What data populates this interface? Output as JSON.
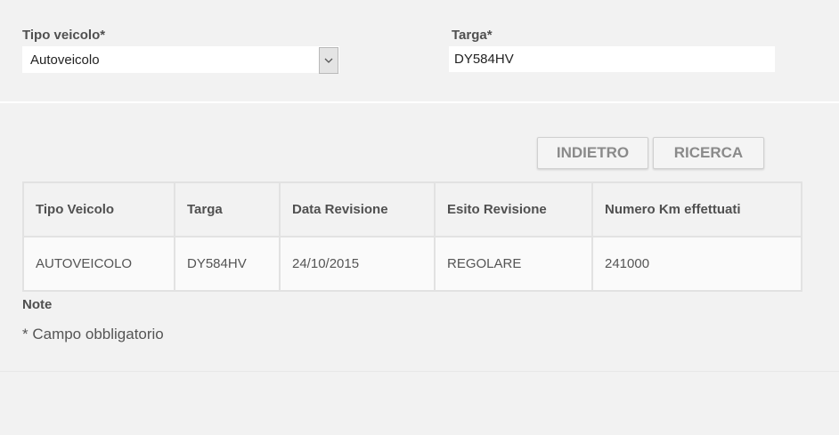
{
  "form": {
    "vehicle_type": {
      "label": "Tipo veicolo*",
      "value": "Autoveicolo"
    },
    "plate": {
      "label": "Targa*",
      "value": "DY584HV"
    }
  },
  "actions": {
    "back_label": "INDIETRO",
    "search_label": "RICERCA"
  },
  "results": {
    "headers": [
      "Tipo Veicolo",
      "Targa",
      "Data Revisione",
      "Esito Revisione",
      "Numero Km effettuati"
    ],
    "rows": [
      [
        "AUTOVEICOLO",
        "DY584HV",
        "24/10/2015",
        "REGOLARE",
        "241000"
      ]
    ]
  },
  "notes": {
    "title": "Note",
    "text": "* Campo obbligatorio"
  },
  "icons": {
    "select_arrow": "chevron-down-icon"
  },
  "colors": {
    "background": "#f2f2f2",
    "input_background": "#ffffff",
    "button_text": "#8a8a8a"
  }
}
